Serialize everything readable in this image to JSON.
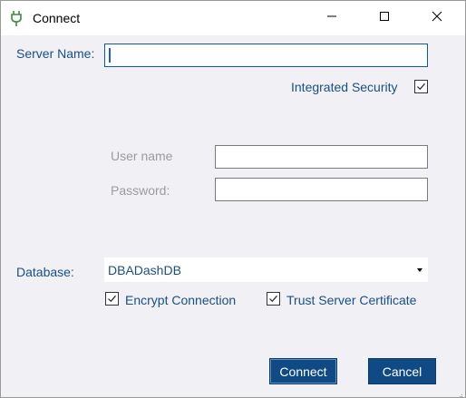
{
  "window": {
    "title": "Connect",
    "app_icon": "plug-icon",
    "controls": [
      "minimize-icon",
      "maximize-icon",
      "close-icon"
    ]
  },
  "form": {
    "server_name_label": "Server Name:",
    "server_name_value": "",
    "integrated_security_label": "Integrated Security",
    "integrated_security_checked": true,
    "user_name_label": "User name",
    "user_name_value": "",
    "password_label": "Password:",
    "password_value": "",
    "database_label": "Database:",
    "database_value": "DBADashDB",
    "encrypt_connection_label": "Encrypt Connection",
    "encrypt_connection_checked": true,
    "trust_server_certificate_label": "Trust Server Certificate",
    "trust_server_certificate_checked": true
  },
  "buttons": {
    "connect_label": "Connect",
    "cancel_label": "Cancel"
  },
  "colors": {
    "label_text": "#1a4f86",
    "disabled_text": "#9c9c9c",
    "button_bg": "#0f4a84",
    "dialog_bg": "#f0f0f5",
    "plug_icon": "#3c8a3c"
  }
}
